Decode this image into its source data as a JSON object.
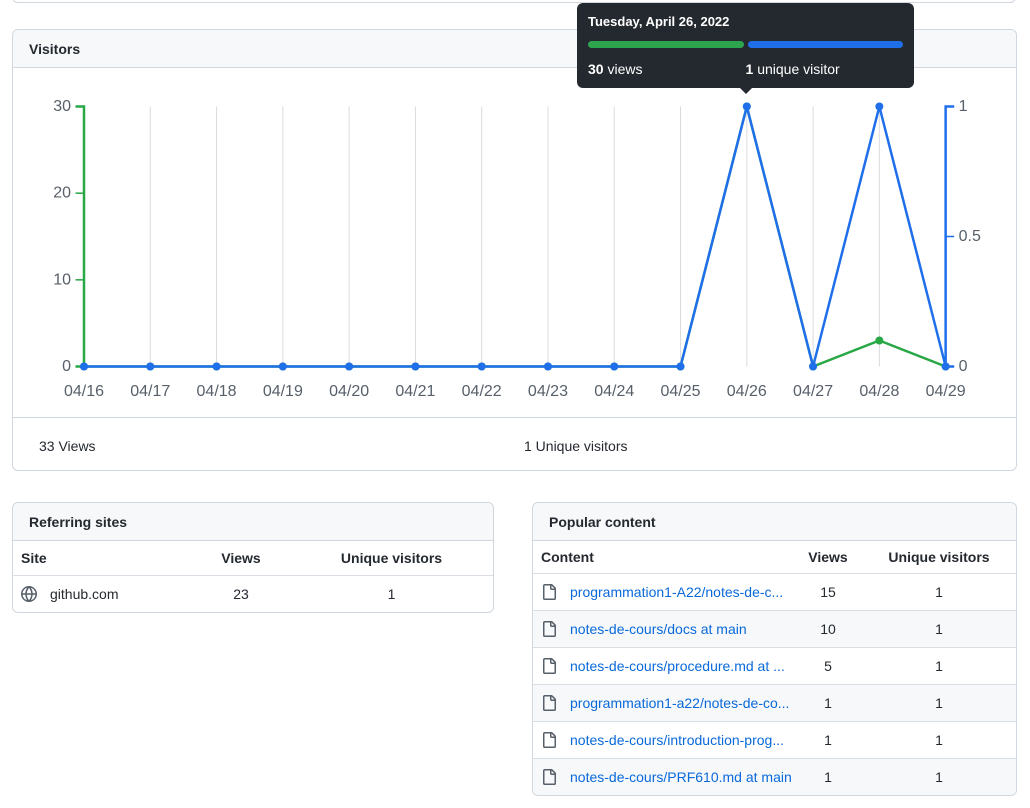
{
  "page": {
    "background": "#ffffff"
  },
  "visitors_card": {
    "title": "Visitors",
    "summary": {
      "views_total": "33 Views",
      "unique_total": "1 Unique visitors"
    }
  },
  "tooltip": {
    "title": "Tuesday, April 26, 2022",
    "views_value": "30",
    "views_label": "views",
    "unique_value": "1",
    "unique_label": "unique visitor",
    "views_bar_color": "#2da44e",
    "unique_bar_color": "#1f6feb",
    "background": "#24292f"
  },
  "chart_data": {
    "type": "line",
    "title": "Visitors",
    "x": [
      "04/16",
      "04/17",
      "04/18",
      "04/19",
      "04/20",
      "04/21",
      "04/22",
      "04/23",
      "04/24",
      "04/25",
      "04/26",
      "04/27",
      "04/28",
      "04/29"
    ],
    "series": [
      {
        "name": "views",
        "axis": "left",
        "color": "#28a745",
        "values": [
          0,
          0,
          0,
          0,
          0,
          0,
          0,
          0,
          0,
          0,
          30,
          0,
          3,
          0
        ]
      },
      {
        "name": "unique visitors",
        "axis": "right",
        "color": "#1f6feb",
        "values": [
          0,
          0,
          0,
          0,
          0,
          0,
          0,
          0,
          0,
          0,
          1,
          0,
          1,
          0
        ]
      }
    ],
    "left_axis": {
      "range": [
        0,
        30
      ],
      "ticks": [
        0,
        10,
        20,
        30
      ],
      "labels": [
        "0",
        "10",
        "20",
        "30"
      ],
      "color": "#28a745"
    },
    "right_axis": {
      "range": [
        0,
        1
      ],
      "ticks": [
        0,
        0.5,
        1
      ],
      "labels": [
        "0",
        "0.5",
        "1"
      ],
      "color": "#1f6feb"
    },
    "grid": "vertical",
    "gridline_color": "#d8dbdf",
    "tick_label_color": "#57606a"
  },
  "referring_sites": {
    "title": "Referring sites",
    "columns": {
      "label": "Site",
      "views": "Views",
      "unique": "Unique visitors"
    },
    "rows": [
      {
        "label": "github.com",
        "views": "23",
        "unique": "1",
        "icon": "globe-icon"
      }
    ]
  },
  "popular_content": {
    "title": "Popular content",
    "columns": {
      "label": "Content",
      "views": "Views",
      "unique": "Unique visitors"
    },
    "rows": [
      {
        "label": "programmation1-A22/notes-de-c...",
        "views": "15",
        "unique": "1",
        "icon": "file-icon"
      },
      {
        "label": "notes-de-cours/docs at main",
        "views": "10",
        "unique": "1",
        "icon": "file-icon"
      },
      {
        "label": "notes-de-cours/procedure.md at ...",
        "views": "5",
        "unique": "1",
        "icon": "file-icon"
      },
      {
        "label": "programmation1-a22/notes-de-co...",
        "views": "1",
        "unique": "1",
        "icon": "file-icon"
      },
      {
        "label": "notes-de-cours/introduction-prog...",
        "views": "1",
        "unique": "1",
        "icon": "file-icon"
      },
      {
        "label": "notes-de-cours/PRF610.md at main",
        "views": "1",
        "unique": "1",
        "icon": "file-icon"
      }
    ]
  }
}
